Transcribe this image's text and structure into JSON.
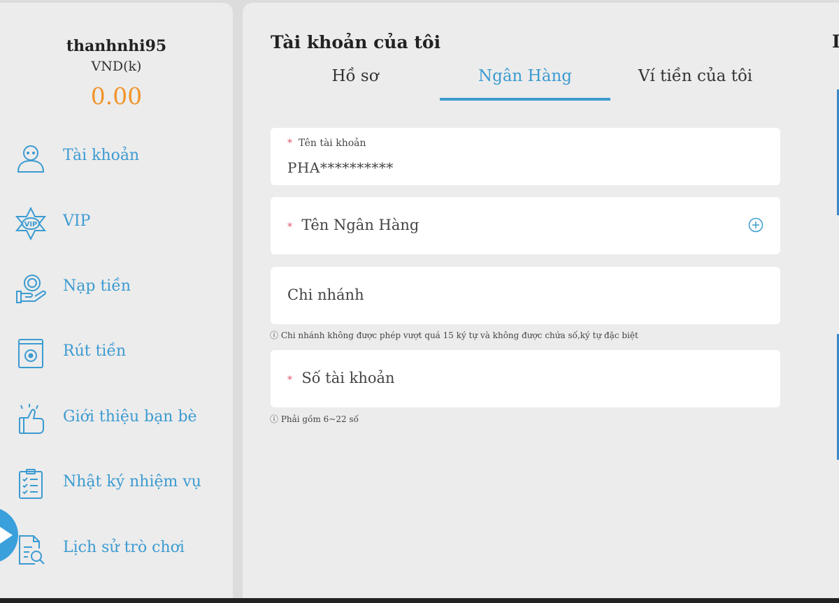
{
  "user": {
    "username": "thanhnhi95",
    "currency": "VND(k)",
    "balance": "0.00"
  },
  "sidebar": {
    "items": [
      {
        "label": "Tài khoản",
        "icon": "user-icon"
      },
      {
        "label": "VIP",
        "icon": "vip-icon"
      },
      {
        "label": "Nạp tiền",
        "icon": "deposit-icon"
      },
      {
        "label": "Rút tiền",
        "icon": "withdraw-icon"
      },
      {
        "label": "Giới thiệu bạn bè",
        "icon": "thumbs-up-icon"
      },
      {
        "label": "Nhật ký nhiệm vụ",
        "icon": "checklist-icon"
      },
      {
        "label": "Lịch sử trò chơi",
        "icon": "game-history-icon"
      }
    ]
  },
  "main": {
    "title": "Tài khoản của tôi",
    "right_peek": "I",
    "tabs": [
      {
        "label": "Hồ sơ",
        "active": false
      },
      {
        "label": "Ngân Hàng",
        "active": true
      },
      {
        "label": "Ví tiền của tôi",
        "active": false
      }
    ],
    "form": {
      "account_name": {
        "required_mark": "*",
        "label": "Tên tài khoản",
        "value": "PHA**********"
      },
      "bank_name": {
        "required_mark": "*",
        "label": "Tên Ngân Hàng",
        "icon": "plus-circle-icon"
      },
      "branch": {
        "label": "Chi nhánh",
        "hint": "ⓘ  Chi nhánh không được phép vượt quá 15 ký tự và không được chứa số,ký tự đặc biệt"
      },
      "account_number": {
        "required_mark": "*",
        "label": "Số tài khoản",
        "hint": "ⓘ  Phải gồm 6~22 số"
      }
    }
  },
  "colors": {
    "accent": "#3c9bd1",
    "balance": "#f0942a",
    "required": "#e0566b",
    "panel": "#ececec"
  }
}
